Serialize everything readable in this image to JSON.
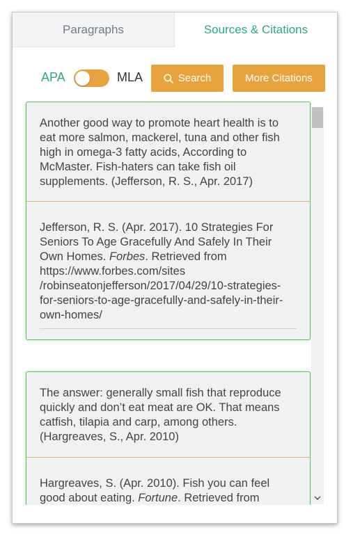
{
  "tabs": [
    {
      "label": "Paragraphs",
      "active": false
    },
    {
      "label": "Sources & Citations",
      "active": true
    }
  ],
  "controls": {
    "apa_label": "APA",
    "mla_label": "MLA",
    "toggle_state": "APA",
    "search_label": "Search",
    "more_citations_label": "More Citations"
  },
  "cards": [
    {
      "quote": "Another good way to promote heart health is to eat more salmon, mackerel, tuna and other fish high in omega-3 fatty acids, According to McMaster. Fish-haters can take fish oil supplements. (Jefferson, R. S., Apr. 2017)",
      "citation_pre": "Jefferson, R. S. (Apr. 2017). 10 Strategies For Seniors To Age Gracefully And Safely In Their Own Homes. ",
      "citation_source": "Forbes",
      "citation_post": ". Retrieved from https://www.forbes.com/sites",
      "citation_url": "/robinseatonjefferson/2017/04/29/10-strategies-for-seniors-to-age-gracefully-and-safely-in-their-own-homes/"
    },
    {
      "quote": "The answer: generally small fish that reproduce quickly and don’t eat meat are OK. That means catfish, tilapia and carp, among others. (Hargreaves, S., Apr. 2010)",
      "citation_pre": "Hargreaves, S. (Apr. 2010). Fish you can feel good about eating. ",
      "citation_source": "Fortune",
      "citation_post": ". Retrieved from"
    }
  ],
  "colors": {
    "accent_green": "#2aab7c",
    "button_orange": "#e8a33d",
    "card_border": "#5cc25a"
  },
  "icons": {
    "search": "search-icon",
    "scroll_down": "chevron-down-icon"
  }
}
